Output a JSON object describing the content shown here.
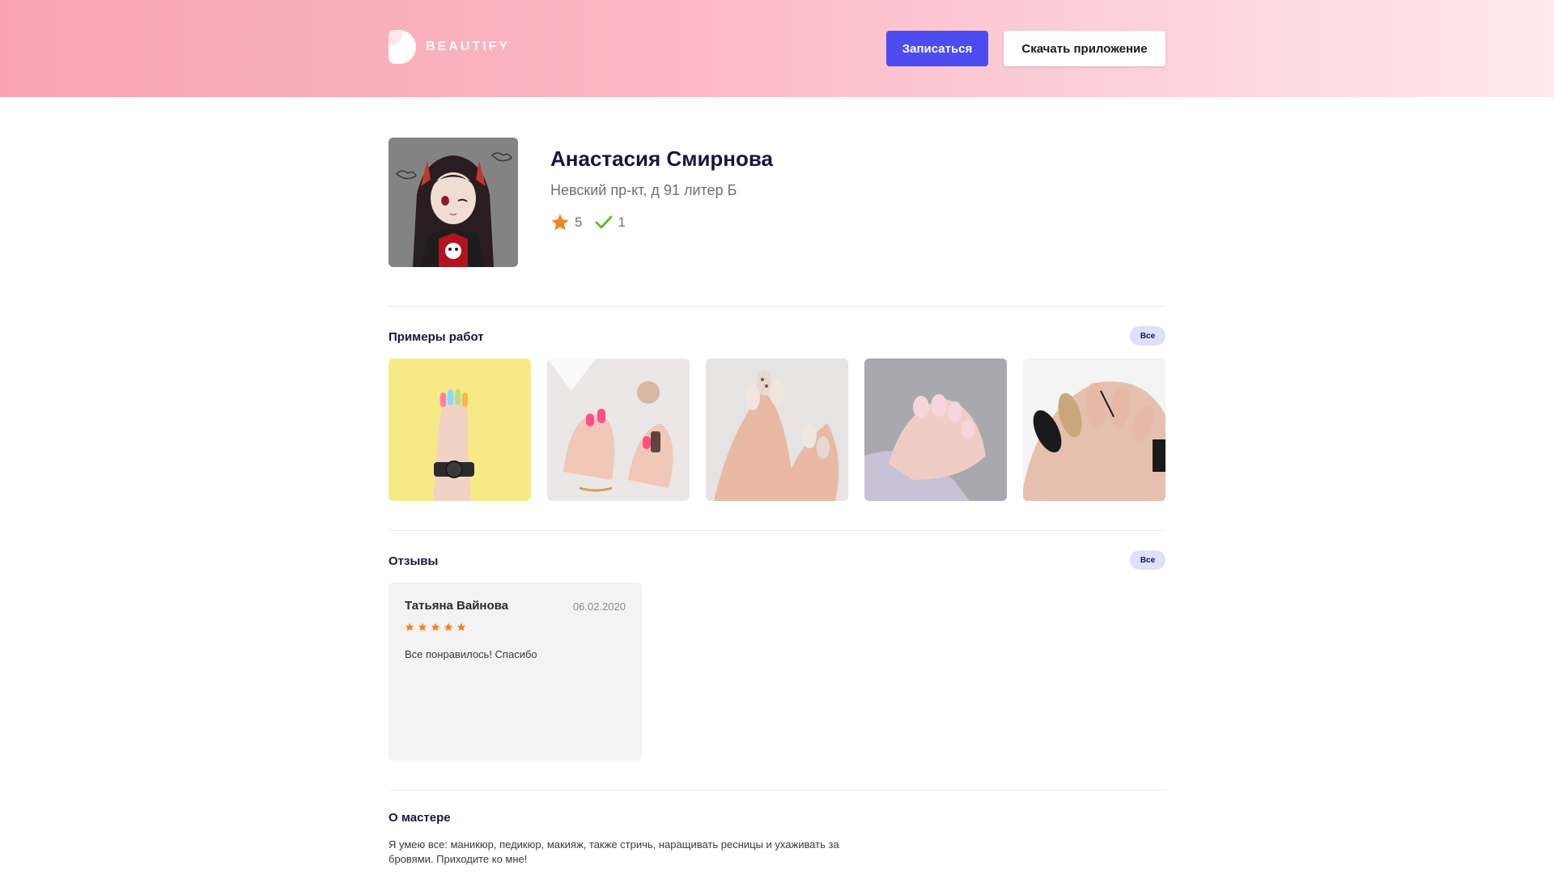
{
  "header": {
    "logo_text": "BEAUTIFY",
    "book_button": "Записаться",
    "download_button": "Скачать приложение"
  },
  "profile": {
    "name": "Анастасия Смирнова",
    "address": "Невский пр-кт, д 91 литер Б",
    "rating": "5",
    "completed": "1"
  },
  "works": {
    "title": "Примеры работ",
    "all_label": "Все",
    "items": [
      "nail-photo-1",
      "nail-photo-2",
      "nail-photo-3",
      "nail-photo-4",
      "nail-photo-5"
    ]
  },
  "reviews": {
    "title": "Отзывы",
    "all_label": "Все",
    "items": [
      {
        "author": "Татьяна Вайнова",
        "date": "06.02.2020",
        "stars": 5,
        "text": "Все понравилось! Спасибо"
      }
    ]
  },
  "about": {
    "title": "О мастере",
    "text": "Я умею все: маникюр, педикюр, макияж, также стричь, наращивать ресницы и ухаживать за бровями. Приходите ко мне!"
  },
  "colors": {
    "accent": "#4c4cf1",
    "star": "#f5811f",
    "check": "#5cb82c",
    "pill_bg": "#dfe0fb"
  }
}
